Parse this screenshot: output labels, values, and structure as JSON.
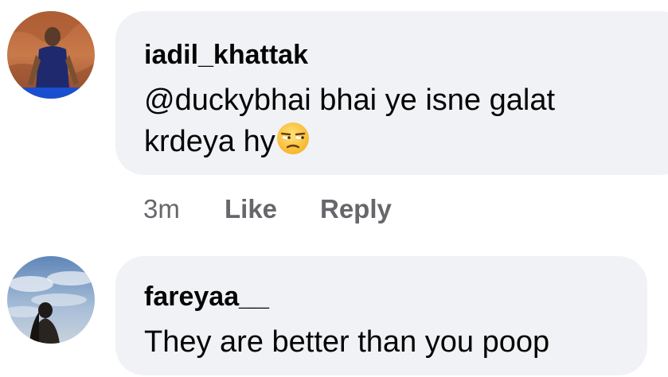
{
  "comments": [
    {
      "username": "iadil_khattak",
      "text_line1": "@duckybhai bhai ye isne galat",
      "text_line2": "krdeya hy",
      "emoji_icon": "unamused-face-emoji",
      "time": "3m",
      "like_label": "Like",
      "reply_label": "Reply"
    },
    {
      "username": "fareyaa__",
      "text": "They are better than you poop"
    }
  ],
  "colors": {
    "bubble": "#f0f2f5",
    "text": "#050505",
    "secondary_text": "#65676b"
  }
}
